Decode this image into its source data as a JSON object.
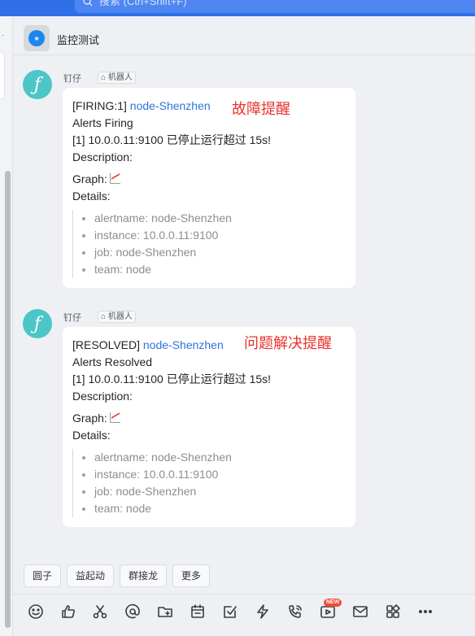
{
  "search": {
    "placeholder": "搜索 (Ctrl+Shift+F)"
  },
  "chat": {
    "title": "监控测试"
  },
  "messages": [
    {
      "sender": "钉仔",
      "bot_tag": "机器人",
      "avatar_glyph": "ƒ",
      "status": "[FIRING:1]",
      "node": "node-Shenzhen",
      "annotation": "故障提醒",
      "line1": "Alerts Firing",
      "line2": "[1] 10.0.0.11:9100 已停止运行超过 15s!",
      "description": "Description:",
      "graph": "Graph:",
      "details": "Details:",
      "details_items": [
        "alertname: node-Shenzhen",
        "instance: 10.0.0.11:9100",
        "job: node-Shenzhen",
        "team: node"
      ]
    },
    {
      "sender": "钉仔",
      "bot_tag": "机器人",
      "avatar_glyph": "ƒ",
      "status": "[RESOLVED]",
      "node": "node-Shenzhen",
      "annotation": "问题解决提醒",
      "line1": "Alerts Resolved",
      "line2": "[1] 10.0.0.11:9100 已停止运行超过 15s!",
      "description": "Description:",
      "graph": "Graph:",
      "details": "Details:",
      "details_items": [
        "alertname: node-Shenzhen",
        "instance: 10.0.0.11:9100",
        "job: node-Shenzhen",
        "team: node"
      ]
    }
  ],
  "chips": [
    "圆子",
    "益起动",
    "群接龙",
    "更多"
  ],
  "toolbar": {
    "icons": [
      "emoji-icon",
      "thumbs-up-icon",
      "scissors-icon",
      "at-icon",
      "folder-add-icon",
      "calendar-icon",
      "task-check-icon",
      "ding-lightning-icon",
      "phone-icon",
      "video-live-icon",
      "mail-icon",
      "apps-icon",
      "more-icon"
    ],
    "new_badge": "NEW"
  }
}
